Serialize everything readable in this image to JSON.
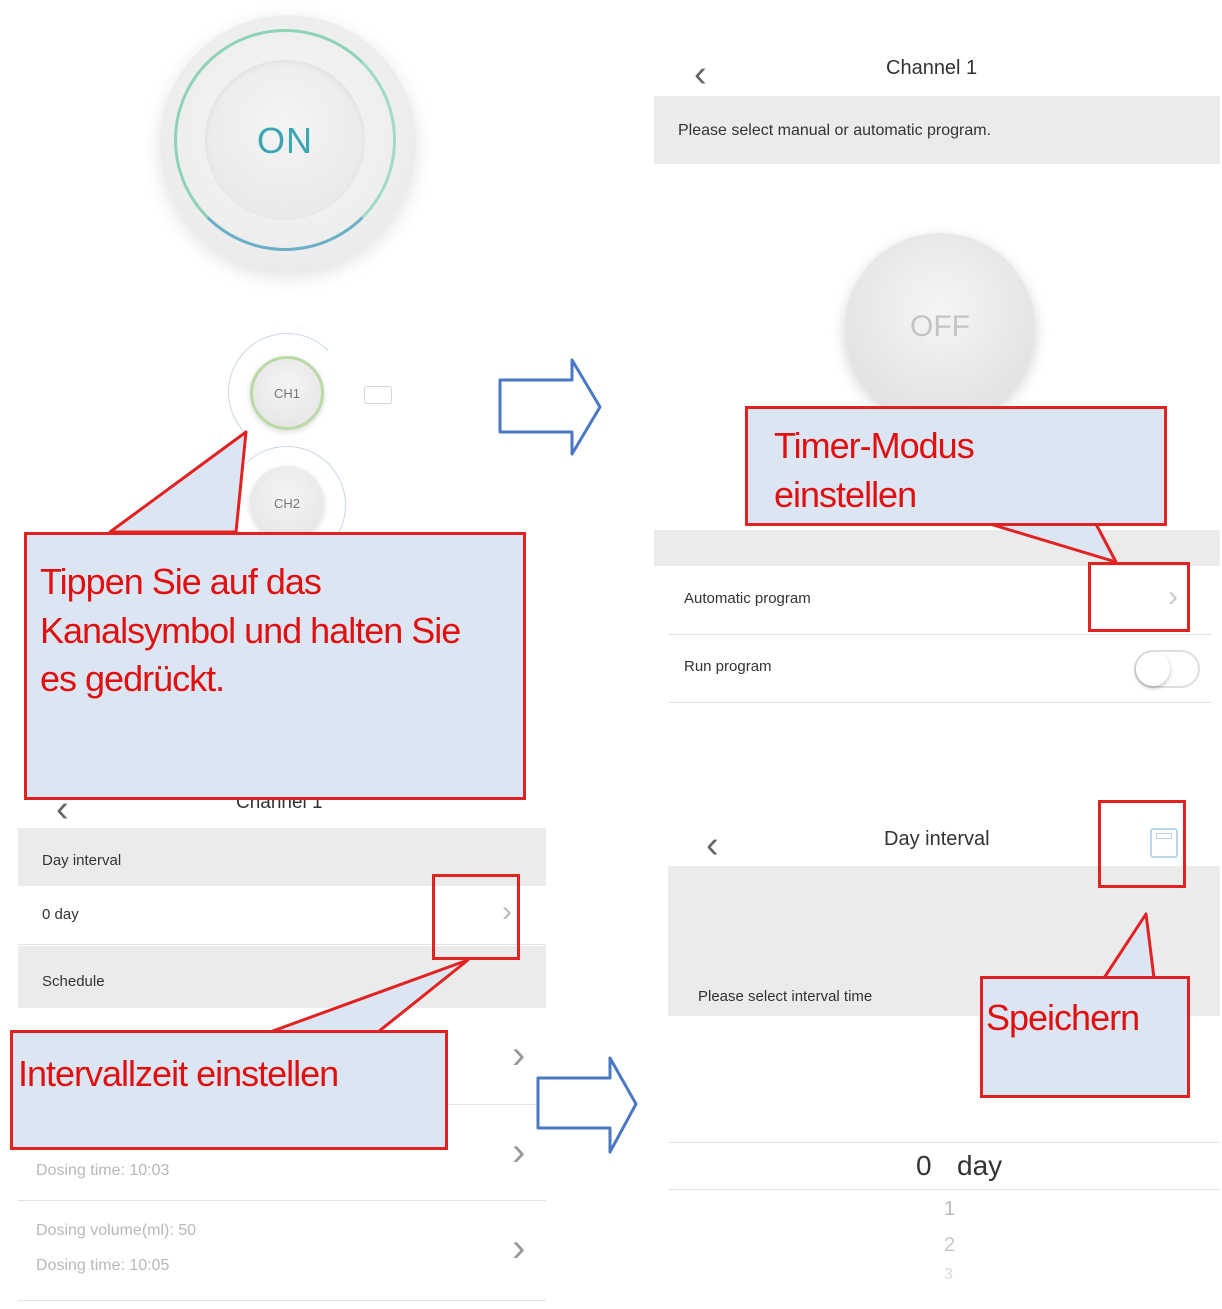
{
  "home": {
    "on_label": "ON",
    "ch1_label": "CH1",
    "ch2_label": "CH2"
  },
  "channel_screen": {
    "title": "Channel 1",
    "prompt": "Please select manual or automatic program.",
    "off_label": "OFF",
    "automatic_program_label": "Automatic program",
    "run_program_label": "Run program",
    "run_program_on": false
  },
  "schedule_screen": {
    "title": "Channel 1",
    "day_interval_header": "Day interval",
    "day_interval_value": "0 day",
    "schedule_header": "Schedule",
    "items": [
      {
        "line1": "",
        "line2": ""
      },
      {
        "line1": "",
        "line2": "Dosing time: 10:03"
      },
      {
        "line1": "Dosing volume(ml): 50",
        "line2": "Dosing time: 10:05"
      }
    ]
  },
  "day_interval_screen": {
    "title": "Day interval",
    "prompt": "Please select interval time",
    "picker_selected_number": "0",
    "picker_selected_unit": "day",
    "picker_options": [
      "1",
      "2",
      "3"
    ]
  },
  "callouts": {
    "hold_channel": "Tippen Sie auf das\nKanalsymbol und halten Sie\nes gedrückt.",
    "timer_mode": "Timer-Modus\neinstellen",
    "interval_time": "Intervallzeit einstellen",
    "save": "Speichern"
  },
  "colors": {
    "accent_on": "#3aa6b4",
    "callout_border": "#e22222",
    "callout_text": "#e01010",
    "callout_fill": "#dce6f2",
    "arrow_blue": "#4a78c4"
  }
}
